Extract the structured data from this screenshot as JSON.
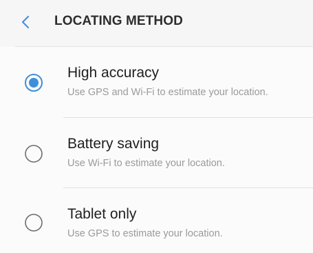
{
  "header": {
    "back_icon": "chevron-left-icon",
    "title": "LOCATING METHOD"
  },
  "colors": {
    "accent": "#3f8fd8",
    "title": "#2d2d2d",
    "description": "#9a9a9a"
  },
  "options": [
    {
      "label": "High accuracy",
      "description": "Use GPS and Wi-Fi to estimate your location.",
      "selected": true
    },
    {
      "label": "Battery saving",
      "description": "Use Wi-Fi to estimate your location.",
      "selected": false
    },
    {
      "label": "Tablet only",
      "description": "Use GPS to estimate your location.",
      "selected": false
    }
  ]
}
